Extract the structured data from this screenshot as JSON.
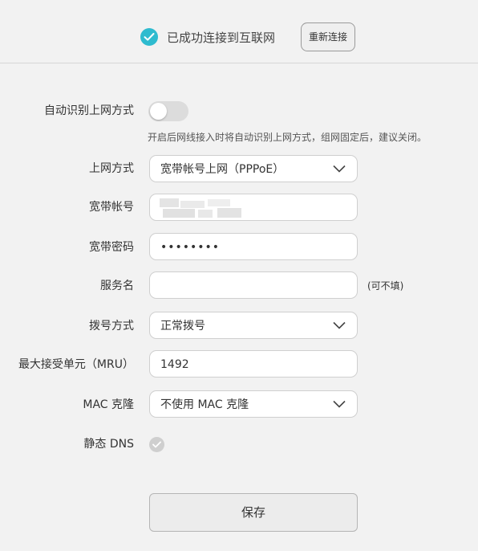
{
  "status": {
    "connected_text": "已成功连接到互联网",
    "reconnect_label": "重新连接",
    "icon": "check-circle-icon",
    "accent_color": "#2ebbcf"
  },
  "form": {
    "auto_detect": {
      "label": "自动识别上网方式",
      "enabled": false,
      "hint": "开启后网线接入时将自动识别上网方式，组网固定后，建议关闭。"
    },
    "connection_type": {
      "label": "上网方式",
      "value": "宽带帐号上网（PPPoE）"
    },
    "account": {
      "label": "宽带帐号",
      "value": ""
    },
    "password": {
      "label": "宽带密码",
      "value": "••••••••"
    },
    "service_name": {
      "label": "服务名",
      "value": "",
      "note": "(可不填)"
    },
    "dial_mode": {
      "label": "拨号方式",
      "value": "正常拨号"
    },
    "mru": {
      "label": "最大接受单元（MRU）",
      "value": "1492"
    },
    "mac_clone": {
      "label": "MAC 克隆",
      "value": "不使用 MAC 克隆"
    },
    "static_dns": {
      "label": "静态 DNS",
      "checked": true
    }
  },
  "save_label": "保存"
}
